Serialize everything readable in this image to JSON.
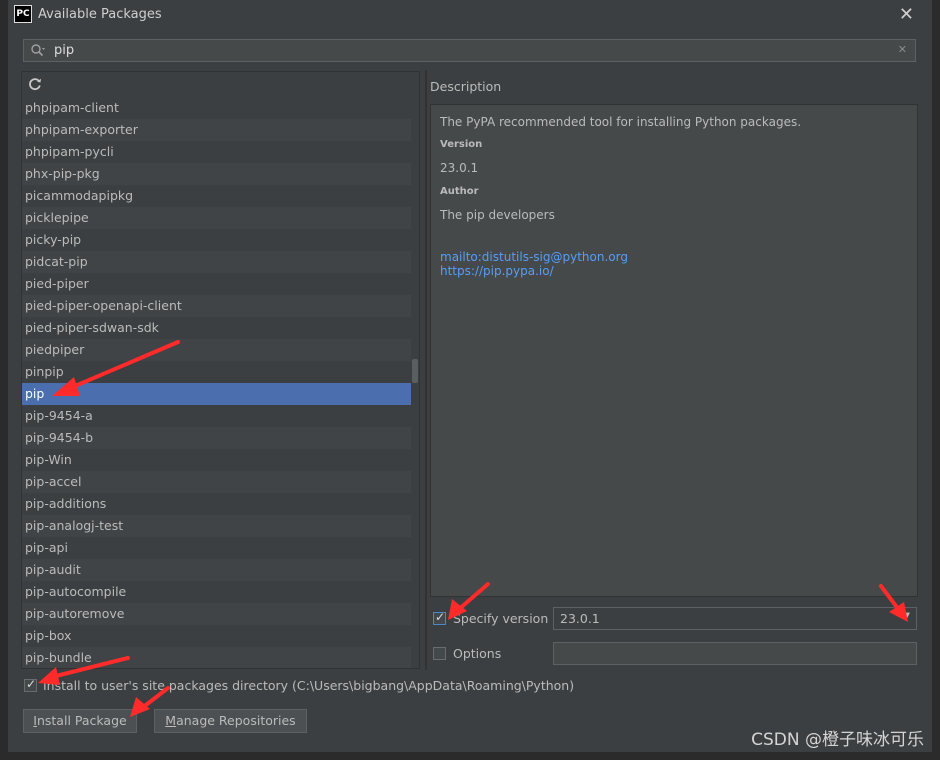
{
  "window": {
    "title": "Available Packages",
    "app_logo_text": "PC"
  },
  "search": {
    "value": "pip"
  },
  "packages": [
    "phpipam-client",
    "phpipam-exporter",
    "phpipam-pycli",
    "phx-pip-pkg",
    "picammodapipkg",
    "picklepipe",
    "picky-pip",
    "pidcat-pip",
    "pied-piper",
    "pied-piper-openapi-client",
    "pied-piper-sdwan-sdk",
    "piedpiper",
    "pinpip",
    "pip",
    "pip-9454-a",
    "pip-9454-b",
    "pip-Win",
    "pip-accel",
    "pip-additions",
    "pip-analogj-test",
    "pip-api",
    "pip-audit",
    "pip-autocompile",
    "pip-autoremove",
    "pip-box",
    "pip-bundle"
  ],
  "selected_package": "pip",
  "description": {
    "label": "Description",
    "text": "The PyPA recommended tool for installing Python packages.",
    "version_heading": "Version",
    "version": "23.0.1",
    "author_heading": "Author",
    "author": "The pip developers",
    "email_link": "mailto:distutils-sig@python.org",
    "url_link": "https://pip.pypa.io/"
  },
  "options": {
    "specify_version_label": "Specify version",
    "specify_version_checked": true,
    "version_value": "23.0.1",
    "options_label": "Options",
    "options_checked": false,
    "options_value": "",
    "install_user_label": "Install to user's site packages directory (C:\\Users\\bigbang\\AppData\\Roaming\\Python)",
    "install_user_checked": true
  },
  "buttons": {
    "install_label_pre": "I",
    "install_label_post": "nstall Package",
    "manage_label_pre": "M",
    "manage_label_post": "anage Repositories"
  },
  "watermark": "CSDN @橙子味冰可乐",
  "colors": {
    "selection": "#4b6eaf",
    "link": "#589df6",
    "arrow": "#ff2a2a"
  }
}
